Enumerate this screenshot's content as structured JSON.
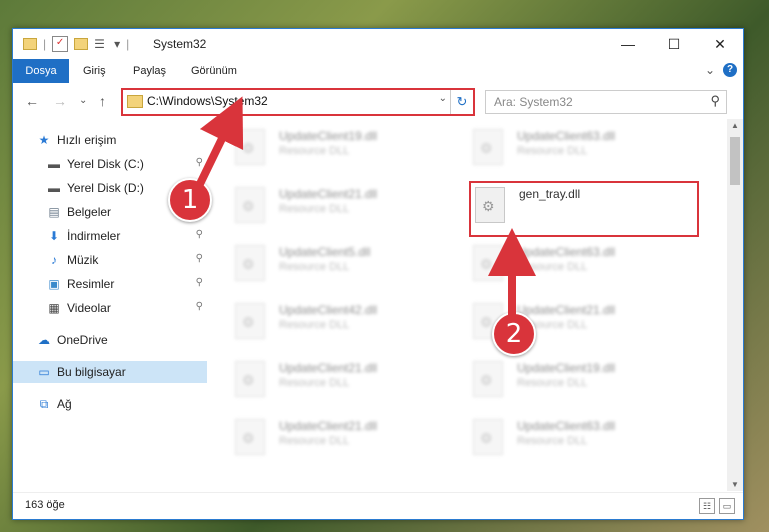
{
  "window": {
    "title": "System32",
    "minimize": "—",
    "maximize": "☐",
    "close": "✕"
  },
  "ribbon": {
    "tabs": [
      "Dosya",
      "Giriş",
      "Paylaş",
      "Görünüm"
    ],
    "expand": "⌄",
    "help": "?"
  },
  "navigation": {
    "back": "←",
    "forward": "→",
    "recent": "⌄",
    "up": "↑",
    "address": "C:\\Windows\\System32",
    "address_dropdown": "⌄",
    "refresh": "↻",
    "search_placeholder": "Ara: System32"
  },
  "sidebar": {
    "items": [
      {
        "label": "Hızlı erişim",
        "icon": "star-icon",
        "glyph": "★",
        "color": "#2a7ad5",
        "pinned": false
      },
      {
        "label": "Yerel Disk (C:)",
        "icon": "drive-icon",
        "glyph": "▬",
        "color": "#555555",
        "pinned": true
      },
      {
        "label": "Yerel Disk (D:)",
        "icon": "drive-icon",
        "glyph": "▬",
        "color": "#555555",
        "pinned": true
      },
      {
        "label": "Belgeler",
        "icon": "documents-icon",
        "glyph": "▤",
        "color": "#6a7a8a",
        "pinned": true
      },
      {
        "label": "İndirmeler",
        "icon": "download-icon",
        "glyph": "⬇",
        "color": "#2a7ad5",
        "pinned": true
      },
      {
        "label": "Müzik",
        "icon": "music-icon",
        "glyph": "♪",
        "color": "#2a7ad5",
        "pinned": true
      },
      {
        "label": "Resimler",
        "icon": "pictures-icon",
        "glyph": "▣",
        "color": "#3a8acb",
        "pinned": true
      },
      {
        "label": "Videolar",
        "icon": "video-icon",
        "glyph": "▦",
        "color": "#444444",
        "pinned": true
      },
      {
        "label": "OneDrive",
        "icon": "cloud-icon",
        "glyph": "☁",
        "color": "#1f6fc5",
        "pinned": false
      },
      {
        "label": "Bu bilgisayar",
        "icon": "computer-icon",
        "glyph": "▭",
        "color": "#2a7ad5",
        "pinned": false,
        "selected": true
      },
      {
        "label": "Ağ",
        "icon": "network-icon",
        "glyph": "⧉",
        "color": "#2a7ad5",
        "pinned": false
      }
    ],
    "pin_glyph": "📌"
  },
  "files": {
    "left_column": [
      {
        "name": "UpdateClient19.dll",
        "type": "Resource DLL"
      },
      {
        "name": "UpdateClient21.dll",
        "type": "Resource DLL"
      },
      {
        "name": "UpdateClient5.dll",
        "type": "Resource DLL"
      },
      {
        "name": "UpdateClient42.dll",
        "type": "Resource DLL"
      },
      {
        "name": "UpdateClient21.dll",
        "type": "Resource DLL"
      },
      {
        "name": "UpdateClient21.dll",
        "type": "Resource DLL"
      }
    ],
    "right_column": [
      {
        "name": "UpdateClient63.dll",
        "type": "Resource DLL"
      },
      {
        "name": "gen_tray.dll",
        "type": "",
        "highlight": true
      },
      {
        "name": "UpdateClient63.dll",
        "type": "Resource DLL"
      },
      {
        "name": "UpdateClient21.dll",
        "type": "Resource DLL"
      },
      {
        "name": "UpdateClient19.dll",
        "type": "Resource DLL"
      },
      {
        "name": "UpdateClient63.dll",
        "type": "Resource DLL"
      }
    ]
  },
  "status": {
    "count": "163 öğe"
  },
  "callouts": [
    "1",
    "2"
  ],
  "colors": {
    "accent": "#1f6fc5",
    "highlight": "#d9343b"
  }
}
